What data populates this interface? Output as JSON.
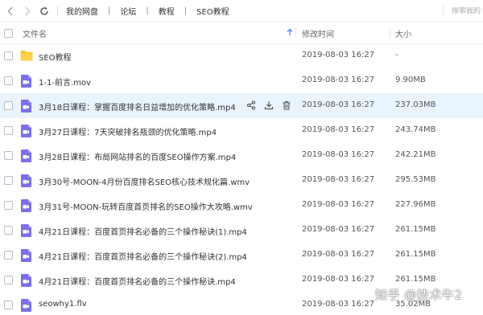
{
  "toolbar": {
    "breadcrumb": [
      "我的网盘",
      "论坛",
      "教程",
      "SEO教程"
    ],
    "search_placeholder": "搜索我的"
  },
  "header": {
    "name_label": "文件名",
    "time_label": "修改时间",
    "size_label": "大小"
  },
  "files": [
    {
      "name": "SEO教程",
      "time": "2019-08-03 16:27",
      "size": "-",
      "type": "folder"
    },
    {
      "name": "1-1-前言.mov",
      "time": "2019-08-03 16:27",
      "size": "9.90MB",
      "type": "video"
    },
    {
      "name": "3月18日课程：掌握百度排名日益增加的优化策略.mp4",
      "time": "2019-08-03 16:27",
      "size": "237.03MB",
      "type": "video"
    },
    {
      "name": "3月27日课程：7天突破排名瓶颈的优化策略.mp4",
      "time": "2019-08-03 16:27",
      "size": "243.74MB",
      "type": "video"
    },
    {
      "name": "3月28日课程：布局网站排名的百度SEO操作方案.mp4",
      "time": "2019-08-03 16:27",
      "size": "242.21MB",
      "type": "video"
    },
    {
      "name": "3月30号-MOON-4月份百度排名SEO核心技术规化篇.wmv",
      "time": "2019-08-03 16:27",
      "size": "295.53MB",
      "type": "video"
    },
    {
      "name": "3月31号-MOON-玩转百度首页排名的SEO操作大攻略.wmv",
      "time": "2019-08-03 16:27",
      "size": "227.96MB",
      "type": "video"
    },
    {
      "name": "4月21日课程：百度首页排名必备的三个操作秘诀(1).mp4",
      "time": "2019-08-03 16:27",
      "size": "261.15MB",
      "type": "video"
    },
    {
      "name": "4月21日课程：百度首页排名必备的三个操作秘诀(2).mp4",
      "time": "2019-08-03 16:27",
      "size": "261.15MB",
      "type": "video"
    },
    {
      "name": "4月21日课程：百度首页排名必备的三个操作秘诀.mp4",
      "time": "2019-08-03 16:27",
      "size": "261.15MB",
      "type": "video"
    },
    {
      "name": "seowhy1.flv",
      "time": "2019-08-03 16:27",
      "size": "35.02MB",
      "type": "video"
    }
  ],
  "hovered_row": 2,
  "watermark": "知乎 @技术牛2",
  "colors": {
    "accent": "#4a90e2",
    "video_icon": "#7b70e8",
    "folder_icon": "#f8c52f",
    "hover_row": "#eaf4fd"
  }
}
